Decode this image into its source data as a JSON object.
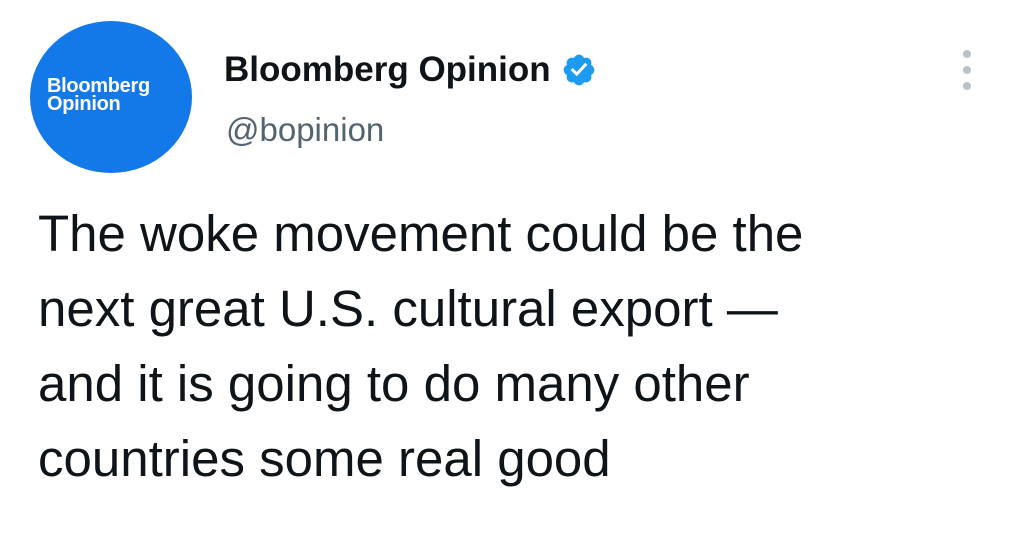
{
  "author": {
    "avatar_line1": "Bloomberg",
    "avatar_line2": "Opinion",
    "avatar_color": "#1378e8",
    "display_name": "Bloomberg Opinion",
    "verified_badge_color": "#1d9bf0",
    "handle": "@bopinion"
  },
  "menu": {
    "icon": "more-vertical-icon"
  },
  "tweet": {
    "text": "The woke movement could be the\nnext great U.S. cultural export —\nand it is going to do many other\ncountries some real good"
  }
}
